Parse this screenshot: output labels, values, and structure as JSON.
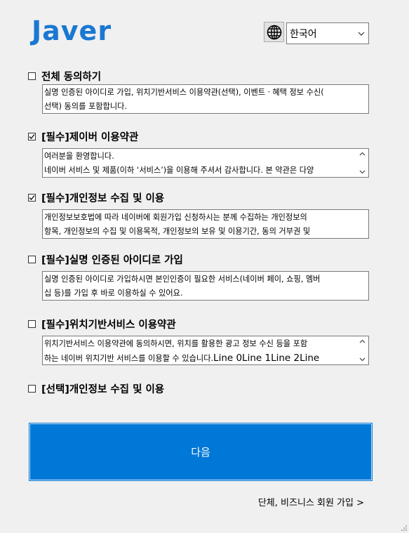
{
  "header": {
    "logo_text": "Javer",
    "language_selected": "한국어"
  },
  "sections": [
    {
      "title": "전체 동의하기",
      "checked": false,
      "lines": [
        "실명 인증된 아이디로 가입, 위치기반서비스 이용약관(선택), 이벤트ㆍ혜택 정보 수신(",
        "선택) 동의를 포함합니다."
      ]
    },
    {
      "title": "[필수]제이버 이용약관",
      "checked": true,
      "lines": [
        "여러분을 환영합니다.",
        "네이버 서비스 및 제품(이하 ‘서비스’)을 이용해 주셔서 감사합니다. 본 약관은 다양"
      ]
    },
    {
      "title": "[필수]개인정보 수집 및 이용",
      "checked": true,
      "lines": [
        "개인정보보호법에 따라 네이버에 회원가입 신청하시는 분께 수집하는 개인정보의",
        "항목, 개인정보의 수집 및 이용목적, 개인정보의 보유 및 이용기간, 동의 거부권 및"
      ]
    },
    {
      "title": "[필수]실명 인증된 아이디로 가입",
      "checked": false,
      "lines": [
        "실명 인증된 아이디로 가입하시면 본인인증이 필요한 서비스(네이버 페이, 쇼핑, 멤버",
        "십 등)를 가입 후 바로 이용하실 수 있어요."
      ]
    },
    {
      "title": "[필수]위치기반서비스 이용약관",
      "checked": false,
      "lines": [
        "위치기반서비스 이용약관에 동의하시면, 위치를 활용한 광고 정보 수신 등을 포함",
        "하는 네이버 위치기반 서비스를 이용할 수 있습니다."
      ],
      "extra": "Line 0Line 1Line 2Line"
    },
    {
      "title": "[선택]개인정보 수집 및 이용",
      "checked": false,
      "lines": []
    }
  ],
  "next_button": "다음",
  "business_link": "단체, 비즈니스 회원 가입 >",
  "colors": {
    "accent": "#0078d7",
    "logo": "#1a78d2",
    "background": "#f0f0f0"
  }
}
